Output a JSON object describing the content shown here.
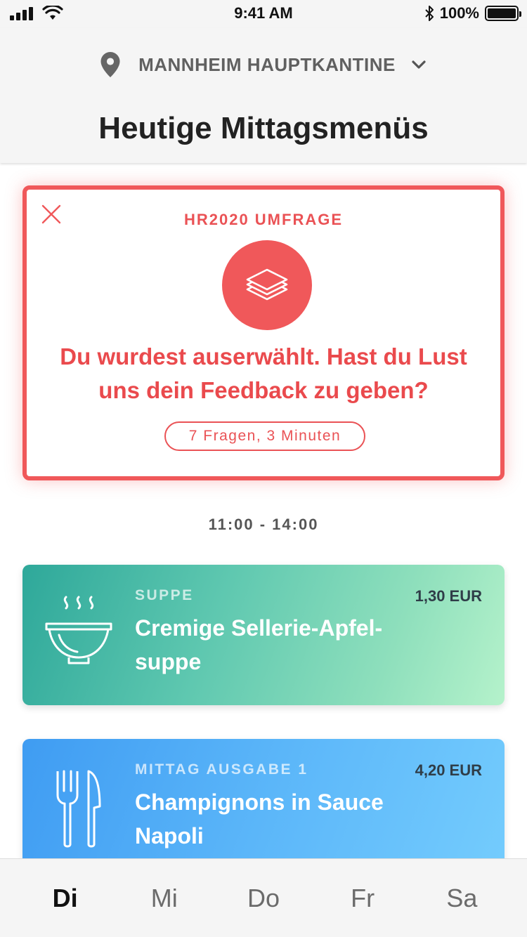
{
  "status_bar": {
    "time": "9:41 AM",
    "battery_percent": "100%",
    "icons": [
      "signal-icon",
      "wifi-icon",
      "bluetooth-icon",
      "battery-icon"
    ]
  },
  "header": {
    "location": "MANNHEIM HAUPTKANTINE",
    "title": "Heutige Mittagsmenüs"
  },
  "survey": {
    "label": "HR2020 UMFRAGE",
    "message": "Du wurdest auserwählt. Hast du Lust uns dein Feedback zu geben?",
    "pill": "7 Fragen, 3 Minuten",
    "accent_color": "#f0585a"
  },
  "time_range": "11:00 - 14:00",
  "menus": [
    {
      "category": "SUPPE",
      "price": "1,30 EUR",
      "name": "Cremige Sellerie-Apfel-suppe",
      "icon": "soup-bowl-icon"
    },
    {
      "category": "MITTAG AUSGABE 1",
      "price": "4,20 EUR",
      "name": "Champignons in Sauce Napoli",
      "icon": "fork-knife-icon"
    }
  ],
  "tabs": [
    {
      "label": "Di",
      "active": true
    },
    {
      "label": "Mi",
      "active": false
    },
    {
      "label": "Do",
      "active": false
    },
    {
      "label": "Fr",
      "active": false
    },
    {
      "label": "Sa",
      "active": false
    }
  ]
}
